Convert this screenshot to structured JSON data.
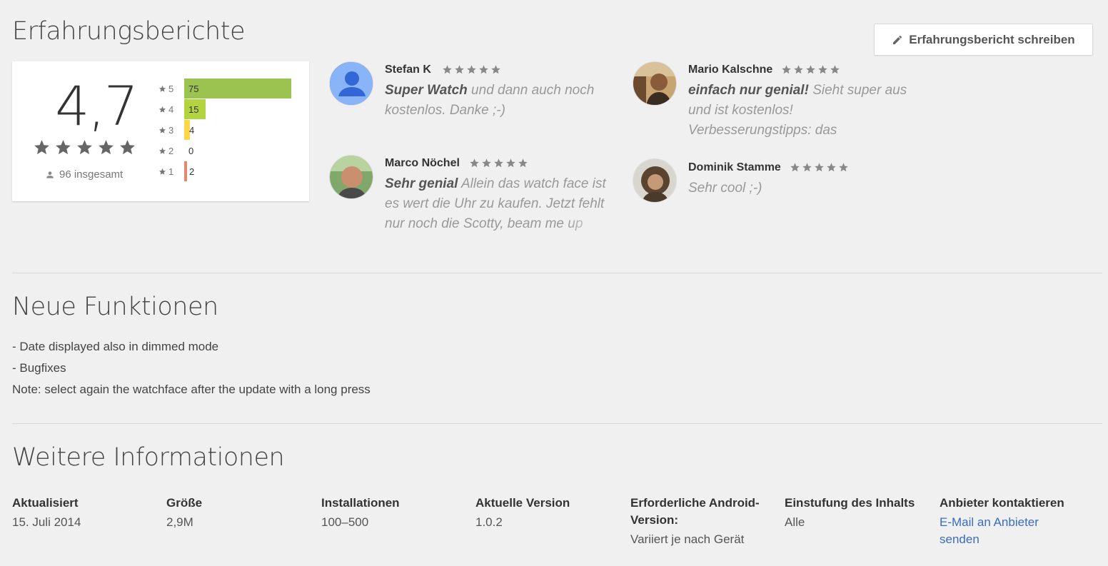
{
  "reviews_section": {
    "title": "Erfahrungsberichte",
    "write_button_label": "Erfahrungsbericht schreiben",
    "write_icon": "pencil-icon",
    "rating": {
      "score": "4,7",
      "stars": 5,
      "total_label": "96 insgesamt",
      "total_icon": "person-icon",
      "histogram": [
        {
          "star": "5",
          "count": "75",
          "value": 75,
          "color": "#9bc34f"
        },
        {
          "star": "4",
          "count": "15",
          "value": 15,
          "color": "#b2d43e"
        },
        {
          "star": "3",
          "count": "4",
          "value": 4,
          "color": "#ffd54a"
        },
        {
          "star": "2",
          "count": "0",
          "value": 0,
          "color": "#f4a35a"
        },
        {
          "star": "1",
          "count": "2",
          "value": 2,
          "color": "#e8886b"
        }
      ]
    },
    "reviews": [
      {
        "name": "Stefan K",
        "stars": 5,
        "bold": "Super Watch",
        "text": " und dann auch noch kostenlos. Danke ;-)",
        "avatar": "default-avatar-icon"
      },
      {
        "name": "Mario Kalschne",
        "stars": 5,
        "bold": "einfach nur genial!",
        "text": " Sieht super aus und ist kostenlos! Verbesserungstipps: das eingeblendete \"okay google\" stört",
        "avatar": "user-photo"
      },
      {
        "name": "Marco Nöchel",
        "stars": 5,
        "bold": "Sehr genial",
        "text": " Allein das watch face ist es wert die Uhr zu kaufen. Jetzt fehlt nur noch die Scotty, beam me up App.",
        "avatar": "user-photo"
      },
      {
        "name": "Dominik Stamme",
        "stars": 5,
        "bold": "",
        "text": "Sehr cool ;-)",
        "avatar": "user-photo"
      }
    ]
  },
  "whats_new": {
    "title": "Neue Funktionen",
    "lines": [
      "- Date displayed also in dimmed mode",
      "- Bugfixes",
      "Note: select again the watchface after the update with a long press"
    ]
  },
  "more_info": {
    "title": "Weitere Informationen",
    "items": [
      {
        "label": "Aktualisiert",
        "value": "15. Juli 2014"
      },
      {
        "label": "Größe",
        "value": "2,9M"
      },
      {
        "label": "Installationen",
        "value": "100–500"
      },
      {
        "label": "Aktuelle Version",
        "value": "1.0.2"
      },
      {
        "label": "Erforderliche Android-Version:",
        "value": "Variiert je nach Gerät"
      },
      {
        "label": "Einstufung des Inhalts",
        "value": "Alle"
      },
      {
        "label": "Anbieter kontaktieren",
        "link": "E-Mail an Anbieter senden"
      }
    ]
  }
}
